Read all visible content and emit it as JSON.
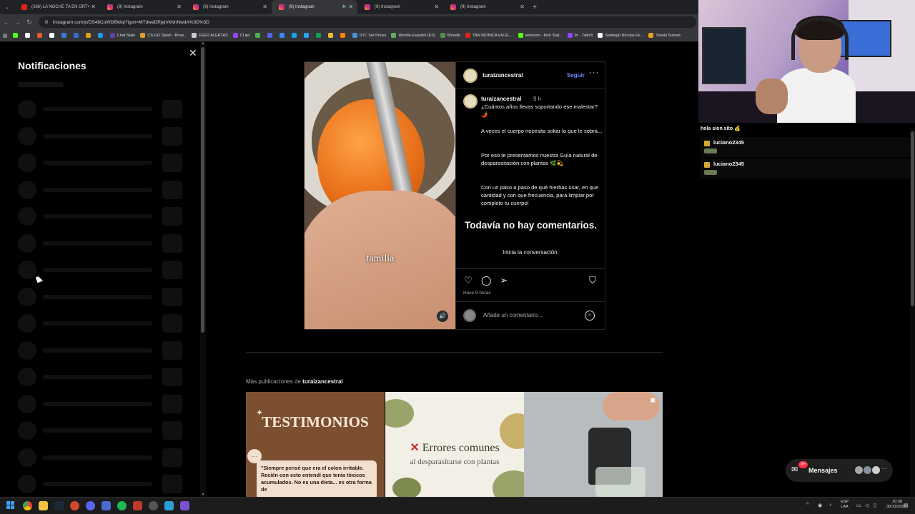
{
  "browser": {
    "tabs": [
      {
        "title": "(266) LA NOCHE TA EN ORT•",
        "favicon": "youtube",
        "active": false
      },
      {
        "title": "(9) Instagram",
        "favicon": "instagram",
        "active": false
      },
      {
        "title": "(9) Instagram",
        "favicon": "instagram",
        "active": false
      },
      {
        "title": "(9) Instagram",
        "favicon": "instagram",
        "active": true
      },
      {
        "title": "(9) Instagram",
        "favicon": "instagram",
        "active": false
      },
      {
        "title": "(9) Instagram",
        "favicon": "instagram",
        "active": false
      }
    ],
    "url": "instagram.com/p/DS48CoWDBWq/?igsh=MTdweDRjejVkNnNwdA%3D%3D",
    "bookmarks": [
      {
        "label": "",
        "color": "#53fc18"
      },
      {
        "label": "",
        "color": "#ffffff"
      },
      {
        "label": "",
        "color": "#e85a2a"
      },
      {
        "label": "",
        "color": "#ffffff"
      },
      {
        "label": "",
        "color": "#3a7bd5"
      },
      {
        "label": "",
        "color": "#2f6fcb"
      },
      {
        "label": "",
        "color": "#d9a21b"
      },
      {
        "label": "",
        "color": "#1d9bf0"
      },
      {
        "label": "Chat Stats",
        "color": "#6441a5"
      },
      {
        "label": "CS:GO Stash - Brow...",
        "color": "#e0a030"
      },
      {
        "label": "FEED ALERTAS",
        "color": "#cccccc"
      },
      {
        "label": "CLips",
        "color": "#9146ff"
      },
      {
        "label": "",
        "color": "#4caf50"
      },
      {
        "label": "",
        "color": "#5865f2"
      },
      {
        "label": "",
        "color": "#3a86ff"
      },
      {
        "label": "",
        "color": "#1da1f2"
      },
      {
        "label": "",
        "color": "#2aa3ef"
      },
      {
        "label": "",
        "color": "#0f9d58"
      },
      {
        "label": "",
        "color": "#f3ba2f"
      },
      {
        "label": "",
        "color": "#ff7f00"
      },
      {
        "label": "STC Set Prices",
        "color": "#4a90d9"
      },
      {
        "label": "Wordle Español (ES)",
        "color": "#6aaa64"
      },
      {
        "label": "Boludle",
        "color": "#538d4e"
      },
      {
        "label": "TAN BIONICA EN EL...",
        "color": "#e62117"
      },
      {
        "label": "sionaron - Kick Stat...",
        "color": "#53fc18"
      },
      {
        "label": "trr - Twitch",
        "color": "#9146ff"
      },
      {
        "label": "Santiago Nicolas Fe...",
        "color": "#ffffff"
      },
      {
        "label": "Tanuki Sunset",
        "color": "#f0a020"
      }
    ]
  },
  "notifications": {
    "title": "Notificaciones",
    "skeleton_rows": 15
  },
  "post": {
    "username": "turaizancestral",
    "follow_label": "Seguir",
    "more_label": "···",
    "time_short": "9 h",
    "caption": [
      "¿Cuántos años llevas soportando ese malestar? 🌶️",
      "A veces el cuerpo necesita soltar lo que le sobra...",
      "Por eso te presentamos nuestra Guía natural de desparasitación con plantas 🌿💫",
      "Con un paso a paso de qué hierbas usar, en que cantidad y con que frecuencia, para limpiar por completo tu cuerpo!"
    ],
    "media_caption": "familia",
    "no_comments_title": "Todavía no hay comentarios.",
    "no_comments_sub": "Inicia la conversación.",
    "posted_ago": "Hace 9 horas",
    "comment_placeholder": "Añade un comentario..."
  },
  "more_posts": {
    "label_prefix": "Más publicaciones de",
    "username": "turaizancestral",
    "thumb1": {
      "title": "TESTIMONIOS",
      "quote": "\"Siempre pensé que era el colon irritable. Recién con esto entendí que tenía tóxicos acumulados. No es una dieta... es otra forma de"
    },
    "thumb2": {
      "mark": "✕",
      "title": "Errores comunes",
      "subtitle": "al desparasitarse con plantas"
    }
  },
  "messages": {
    "label": "Mensajes",
    "badge": "9+",
    "avatar_colors": [
      "#a8a8a8",
      "#8a8fa0",
      "#d0d0d0"
    ]
  },
  "stream": {
    "chat_message": "hola sion sito 💰",
    "chat_users": [
      "luciano2345",
      "luciano2345"
    ]
  },
  "taskbar": {
    "lang_top": "ESP",
    "lang_bottom": "LAA",
    "time": "20:38",
    "date": "30/12/2025"
  },
  "colors": {
    "background": "#000000",
    "link_blue": "#6d86ff",
    "badge_red": "#ff3040",
    "border": "#262626"
  }
}
